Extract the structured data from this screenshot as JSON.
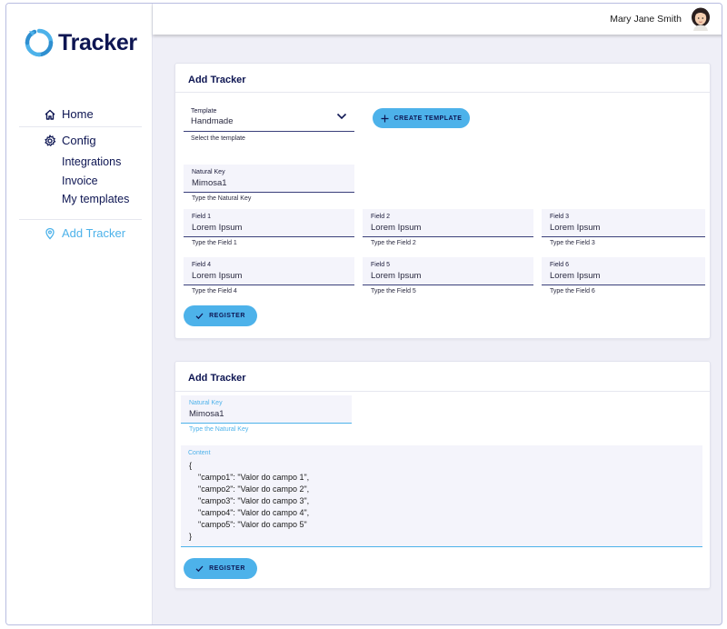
{
  "app": {
    "name": "Tracker"
  },
  "user": {
    "name": "Mary Jane Smith"
  },
  "sidebar": {
    "items": [
      {
        "label": "Home",
        "icon": "home-icon"
      },
      {
        "label": "Config",
        "icon": "gear-icon"
      },
      {
        "label": "Integrations"
      },
      {
        "label": "Invoice"
      },
      {
        "label": "My templates"
      },
      {
        "label": "Add Tracker",
        "icon": "location-pin-icon",
        "active": true
      }
    ]
  },
  "colors": {
    "accent": "#4db2ea",
    "primary": "#0d1552",
    "background": "#efeff7"
  },
  "card1": {
    "title": "Add Tracker",
    "template": {
      "label": "Template",
      "value": "Handmade",
      "helper": "Select the template"
    },
    "create_template_label": "CREATE TEMPLATE",
    "natural_key": {
      "label": "Natural Key",
      "value": "Mimosa1",
      "helper": "Type the Natural Key"
    },
    "fields": [
      {
        "label": "Field 1",
        "value": "Lorem Ipsum",
        "helper": "Type the Field 1"
      },
      {
        "label": "Field 2",
        "value": "Lorem Ipsum",
        "helper": "Type the Field 2"
      },
      {
        "label": "Field 3",
        "value": "Lorem Ipsum",
        "helper": "Type the Field 3"
      },
      {
        "label": "Field 4",
        "value": "Lorem Ipsum",
        "helper": "Type the Field 4"
      },
      {
        "label": "Field 5",
        "value": "Lorem Ipsum",
        "helper": "Type the Field 5"
      },
      {
        "label": "Field 6",
        "value": "Lorem Ipsum",
        "helper": "Type the Field 6"
      }
    ],
    "register_label": "REGISTER"
  },
  "card2": {
    "title": "Add Tracker",
    "natural_key": {
      "label": "Natural Key",
      "value": "Mimosa1",
      "helper": "Type the Natural Key"
    },
    "content": {
      "label": "Content",
      "lines": [
        "{",
        "    \"campo1\": \"Valor do campo 1\",",
        "    \"campo2\": \"Valor do campo 2\",",
        "    \"campo3\": \"Valor do campo 3\",",
        "    \"campo4\": \"Valor do campo 4\",",
        "    \"campo5\": \"Valor do campo 5\"",
        "}"
      ]
    },
    "register_label": "REGISTER"
  }
}
